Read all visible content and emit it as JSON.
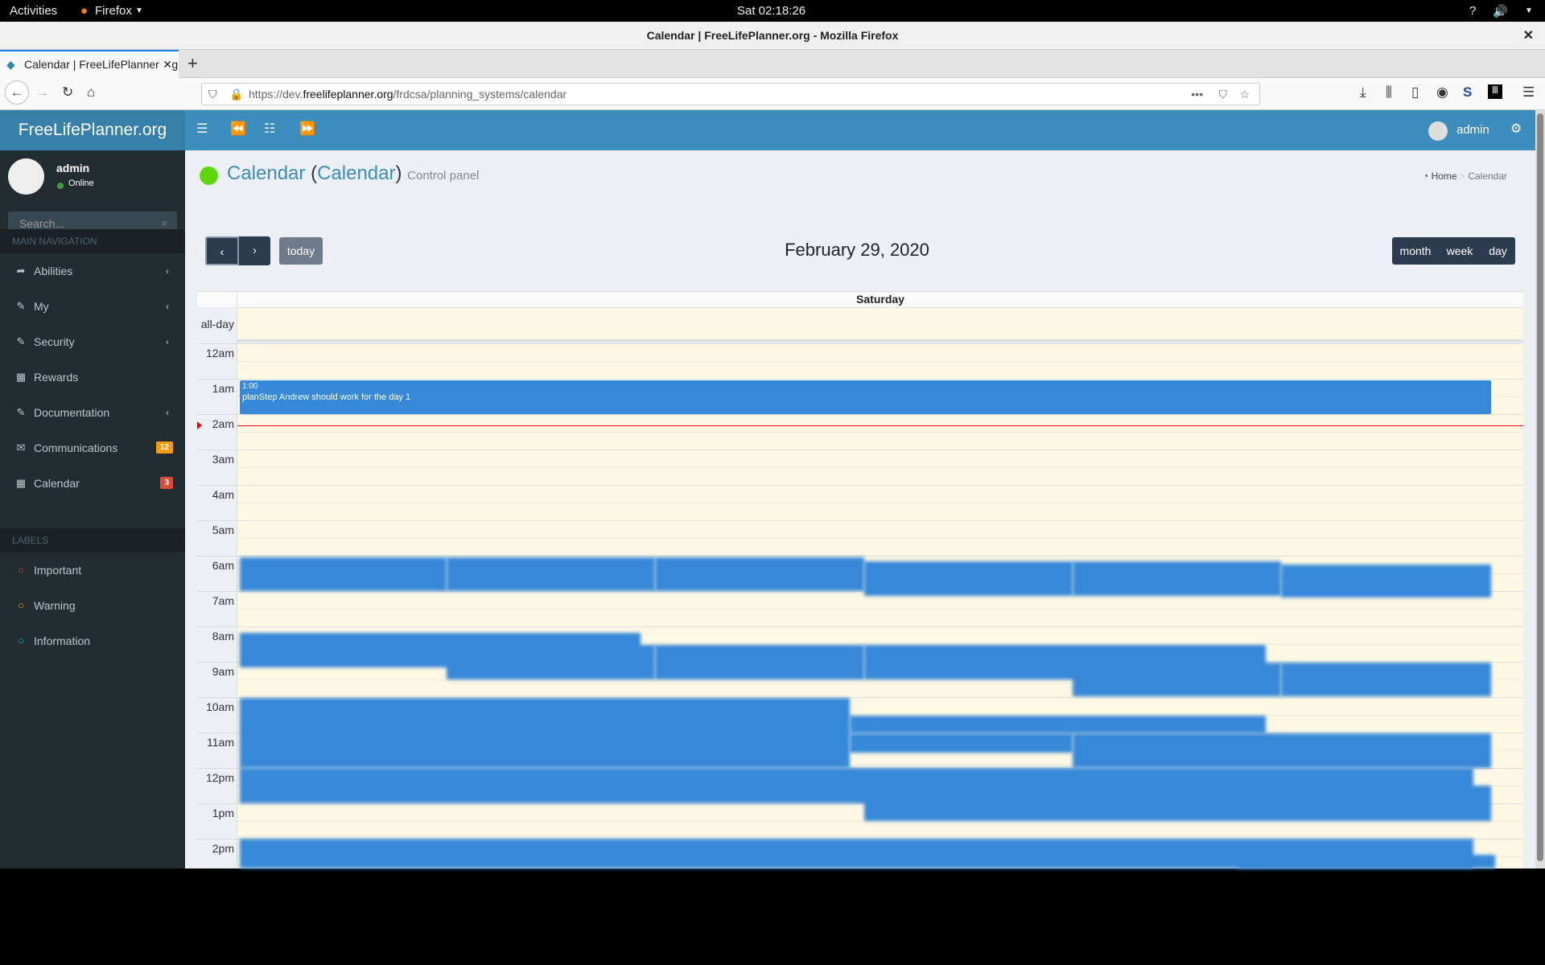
{
  "system": {
    "activities": "Activities",
    "app": "Firefox",
    "clock": "Sat 02:18:26"
  },
  "browser": {
    "window_title": "Calendar | FreeLifePlanner.org - Mozilla Firefox",
    "tab_title": "Calendar | FreeLifePlanner.org",
    "url_prefix": "https://dev.",
    "url_domain": "freelifeplanner.org",
    "url_path": "/frdcsa/planning_systems/calendar"
  },
  "app": {
    "logo": "FreeLifePlanner.org",
    "user": "admin"
  },
  "sidebar": {
    "user": "admin",
    "status": "Online",
    "search_placeholder": "Search...",
    "main_nav": "MAIN NAVIGATION",
    "labels_header": "LABELS",
    "items": [
      {
        "label": "Abilities",
        "icon": "share-icon",
        "chevron": true
      },
      {
        "label": "My",
        "icon": "edit-icon",
        "chevron": true
      },
      {
        "label": "Security",
        "icon": "edit-icon",
        "chevron": true
      },
      {
        "label": "Rewards",
        "icon": "calendar-icon"
      },
      {
        "label": "Documentation",
        "icon": "edit-icon",
        "chevron": true
      },
      {
        "label": "Communications",
        "icon": "envelope-icon",
        "badge": "12",
        "badge_color": "#f39c12"
      },
      {
        "label": "Calendar",
        "icon": "calendar-icon",
        "badge": "3",
        "badge_color": "#dd4b39"
      }
    ],
    "labels": [
      {
        "label": "Important",
        "color": "#dd4b39"
      },
      {
        "label": "Warning",
        "color": "#f39c12"
      },
      {
        "label": "Information",
        "color": "#00c0ef"
      }
    ]
  },
  "page": {
    "title": "Calendar",
    "title_paren": "Calendar",
    "subtitle": "Control panel",
    "status_color": "#5ed80e",
    "breadcrumb_home": "Home",
    "breadcrumb_current": "Calendar"
  },
  "calendar": {
    "today": "today",
    "date_title": "February 29, 2020",
    "views": [
      "month",
      "week",
      "day"
    ],
    "day_header": "Saturday",
    "allday": "all-day",
    "hours": [
      "12am",
      "1am",
      "2am",
      "3am",
      "4am",
      "5am",
      "6am",
      "7am",
      "8am",
      "9am",
      "10am",
      "11am",
      "12pm",
      "1pm",
      "2pm"
    ],
    "event": {
      "time": "1:00",
      "title": "planStep Andrew should work for the day 1"
    },
    "event_color": "#3788d8"
  }
}
